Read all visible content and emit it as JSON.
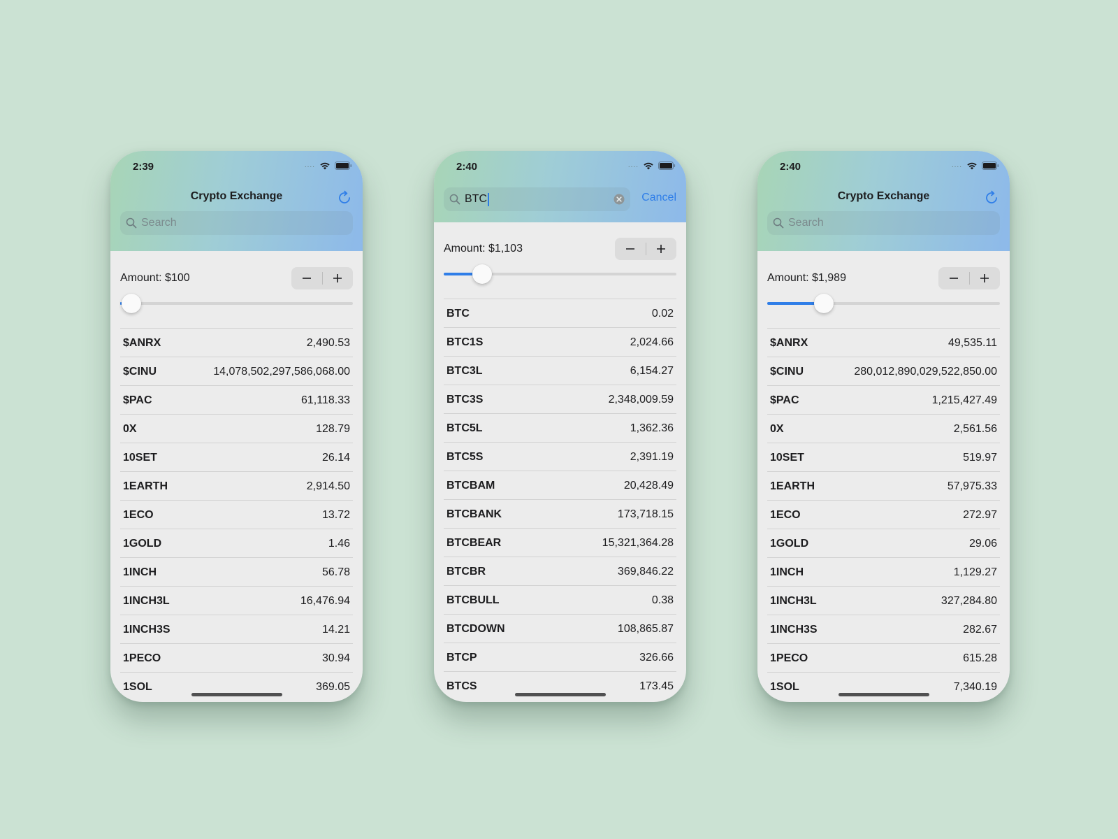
{
  "colors": {
    "accent": "#2f7ee8",
    "background": "#cbe2d3",
    "header_start": "#a8d5b6",
    "header_end": "#8db9ea"
  },
  "screens": [
    {
      "time": "2:39",
      "title": "Crypto Exchange",
      "search": {
        "placeholder": "Search",
        "value": ""
      },
      "amount_label": "Amount: $100",
      "slider_value": 0.005,
      "rows": [
        {
          "symbol": "$ANRX",
          "value": "2,490.53"
        },
        {
          "symbol": "$CINU",
          "value": "14,078,502,297,586,068.00"
        },
        {
          "symbol": "$PAC",
          "value": "61,118.33"
        },
        {
          "symbol": "0X",
          "value": "128.79"
        },
        {
          "symbol": "10SET",
          "value": "26.14"
        },
        {
          "symbol": "1EARTH",
          "value": "2,914.50"
        },
        {
          "symbol": "1ECO",
          "value": "13.72"
        },
        {
          "symbol": "1GOLD",
          "value": "1.46"
        },
        {
          "symbol": "1INCH",
          "value": "56.78"
        },
        {
          "symbol": "1INCH3L",
          "value": "16,476.94"
        },
        {
          "symbol": "1INCH3S",
          "value": "14.21"
        },
        {
          "symbol": "1PECO",
          "value": "30.94"
        },
        {
          "symbol": "1SOL",
          "value": "369.05"
        }
      ]
    },
    {
      "time": "2:40",
      "search": {
        "value": "BTC",
        "cancel_label": "Cancel"
      },
      "amount_label": "Amount: $1,103",
      "slider_value": 0.135,
      "rows": [
        {
          "symbol": "BTC",
          "value": "0.02"
        },
        {
          "symbol": "BTC1S",
          "value": "2,024.66"
        },
        {
          "symbol": "BTC3L",
          "value": "6,154.27"
        },
        {
          "symbol": "BTC3S",
          "value": "2,348,009.59"
        },
        {
          "symbol": "BTC5L",
          "value": "1,362.36"
        },
        {
          "symbol": "BTC5S",
          "value": "2,391.19"
        },
        {
          "symbol": "BTCBAM",
          "value": "20,428.49"
        },
        {
          "symbol": "BTCBANK",
          "value": "173,718.15"
        },
        {
          "symbol": "BTCBEAR",
          "value": "15,321,364.28"
        },
        {
          "symbol": "BTCBR",
          "value": "369,846.22"
        },
        {
          "symbol": "BTCBULL",
          "value": "0.38"
        },
        {
          "symbol": "BTCDOWN",
          "value": "108,865.87"
        },
        {
          "symbol": "BTCP",
          "value": "326.66"
        },
        {
          "symbol": "BTCS",
          "value": "173.45"
        }
      ]
    },
    {
      "time": "2:40",
      "title": "Crypto Exchange",
      "search": {
        "placeholder": "Search",
        "value": ""
      },
      "amount_label": "Amount: $1,989",
      "slider_value": 0.22,
      "rows": [
        {
          "symbol": "$ANRX",
          "value": "49,535.11"
        },
        {
          "symbol": "$CINU",
          "value": "280,012,890,029,522,850.00"
        },
        {
          "symbol": "$PAC",
          "value": "1,215,427.49"
        },
        {
          "symbol": "0X",
          "value": "2,561.56"
        },
        {
          "symbol": "10SET",
          "value": "519.97"
        },
        {
          "symbol": "1EARTH",
          "value": "57,975.33"
        },
        {
          "symbol": "1ECO",
          "value": "272.97"
        },
        {
          "symbol": "1GOLD",
          "value": "29.06"
        },
        {
          "symbol": "1INCH",
          "value": "1,129.27"
        },
        {
          "symbol": "1INCH3L",
          "value": "327,284.80"
        },
        {
          "symbol": "1INCH3S",
          "value": "282.67"
        },
        {
          "symbol": "1PECO",
          "value": "615.28"
        },
        {
          "symbol": "1SOL",
          "value": "7,340.19"
        }
      ]
    }
  ]
}
